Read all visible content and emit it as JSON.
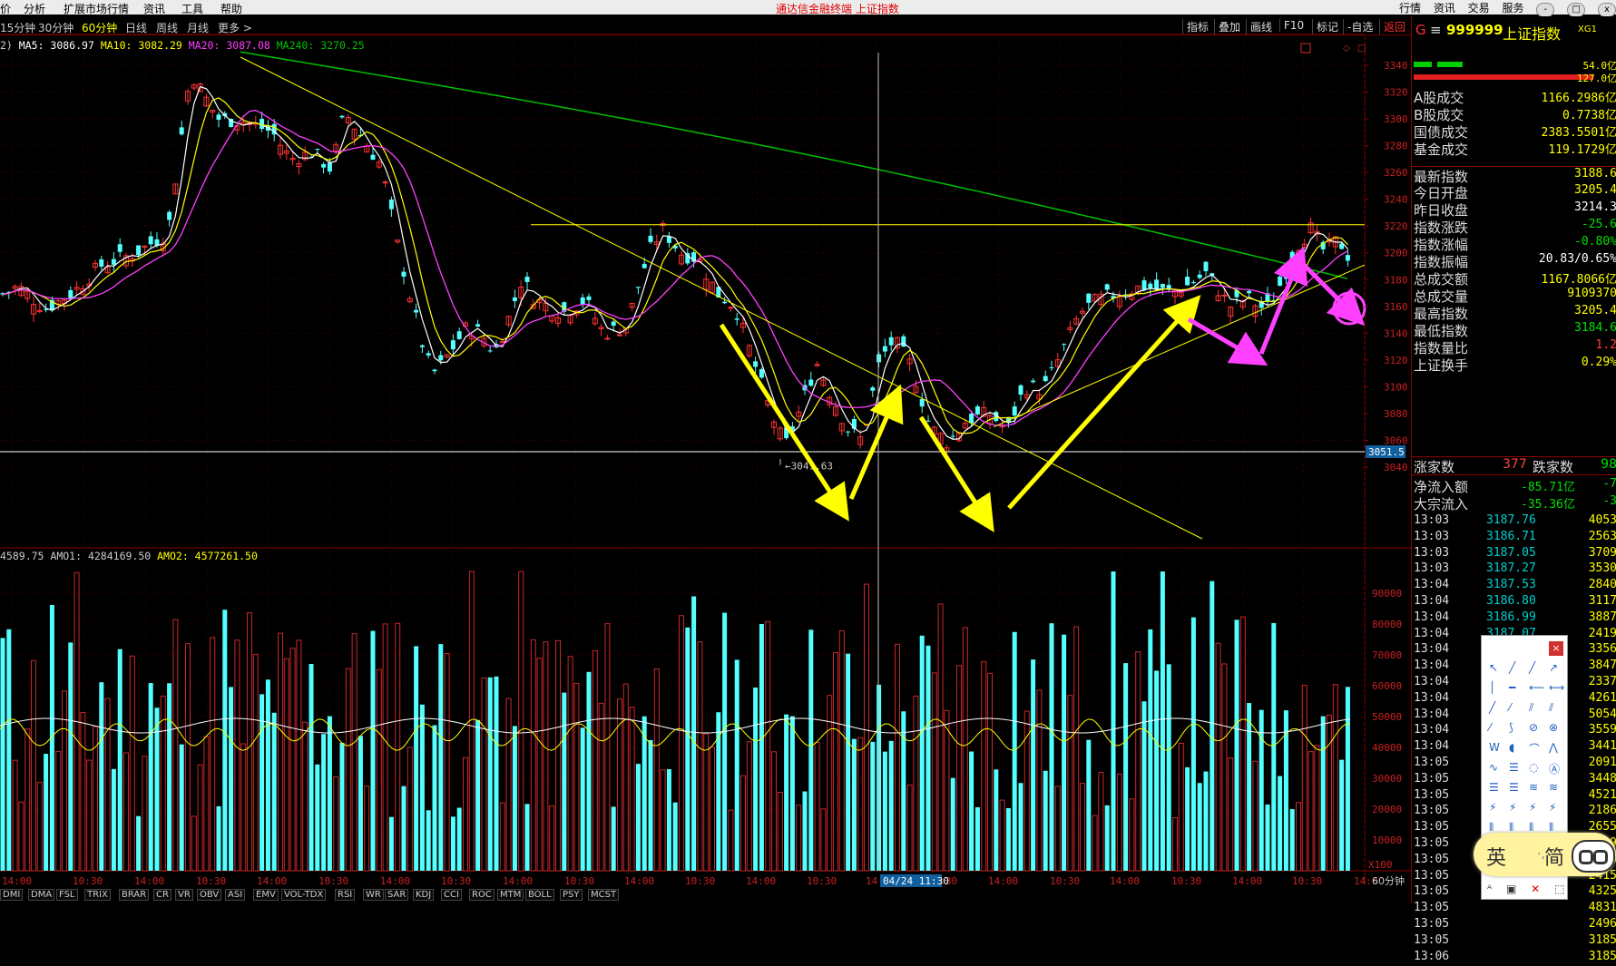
{
  "menubar": {
    "items": [
      "价",
      "分析",
      "扩展市场行情",
      "资讯",
      "工具",
      "帮助"
    ],
    "title": "通达信金融终端    上证指数",
    "right": [
      "行情",
      "资讯",
      "交易",
      "服务"
    ],
    "win_buttons": [
      "-",
      "□",
      "x"
    ]
  },
  "periods": [
    "15分钟",
    "30分钟",
    "60分钟",
    "日线",
    "周线",
    "月线",
    "更多 >"
  ],
  "active_period": "60分钟",
  "tools": [
    "指标",
    "叠加",
    "画线",
    "F10",
    "标记",
    "-自选",
    "返回"
  ],
  "ma_legend": {
    "prefix": "2)",
    "ma5": "MA5: 3086.97",
    "ma10": "MA10: 3082.29",
    "ma20": "MA20: 3087.08",
    "ma240": "MA240: 3270.25",
    "colors": {
      "ma5": "#ffffff",
      "ma10": "#ffff00",
      "ma20": "#ff40ff",
      "ma240": "#00c000"
    }
  },
  "vol_legend": {
    "vol": "4589.75",
    "amo1": "AMO1: 4284169.50",
    "amo2": "AMO2: 4577261.50"
  },
  "price_axis": [
    "3340",
    "3320",
    "3300",
    "3280",
    "3260",
    "3240",
    "3220",
    "3200",
    "3180",
    "3160",
    "3140",
    "3120",
    "3100",
    "3080",
    "3060",
    "3040"
  ],
  "price_marker": "3051.5",
  "low_label": "3041.63",
  "vol_axis": [
    "90000",
    "80000",
    "70000",
    "60000",
    "50000",
    "40000",
    "30000",
    "20000",
    "10000"
  ],
  "vol_unit": "X100",
  "x_axis": [
    "14:00",
    "10:30",
    "14:00",
    "10:30",
    "14:00",
    "10:30",
    "14:00",
    "10:30",
    "14:00",
    "10:30",
    "14:00",
    "10:30",
    "14:00",
    "10:30",
    "14:00",
    "10:30",
    "14:00",
    "10:30",
    "14:00",
    "10:30",
    "14:00",
    "10:30",
    "14:0"
  ],
  "cursor_label": "04/24 11:30",
  "x_unit": "60分钟",
  "bottom_tabs": [
    "DMI",
    "DMA",
    "FSL",
    "TRIX",
    "BRAR",
    "CR",
    "VR",
    "OBV",
    "ASI",
    "EMV",
    "VOL-TDX",
    "RSI",
    "WR",
    "SAR",
    "KDJ",
    "CCI",
    "ROC",
    "MTM",
    "BOLL",
    "PSY",
    "MCST"
  ],
  "right_panel": {
    "header_g": "G",
    "header_code": "999999",
    "header_name": "上证指数",
    "header_tag": "XG1",
    "bar_vals": [
      "54.0亿",
      "127.0亿"
    ],
    "turnover": [
      {
        "label": "A股成交",
        "value": "1166.2986亿"
      },
      {
        "label": "B股成交",
        "value": "0.7738亿"
      },
      {
        "label": "国债成交",
        "value": "2383.5501亿"
      },
      {
        "label": "基金成交",
        "value": "119.1729亿"
      }
    ],
    "stats": [
      {
        "label": "最新指数",
        "value": "3188.6",
        "color": "#ffff00"
      },
      {
        "label": "今日开盘",
        "value": "3205.4",
        "color": "#ffff00"
      },
      {
        "label": "昨日收盘",
        "value": "3214.3",
        "color": "#ffffff"
      },
      {
        "label": "指数涨跌",
        "value": "-25.6",
        "color": "#00e000"
      },
      {
        "label": "指数涨幅",
        "value": "-0.80%",
        "color": "#00e000"
      },
      {
        "label": "指数振幅",
        "value": "20.83/0.65%",
        "color": "#ffffff"
      },
      {
        "label": "总成交额",
        "value": "1167.8066亿",
        "color": "#ffff00"
      },
      {
        "label": "总成交量",
        "value": "9109370",
        "color": "#ffff00"
      },
      {
        "label": "最高指数",
        "value": "3205.4",
        "color": "#ffff00"
      },
      {
        "label": "最低指数",
        "value": "3184.6",
        "color": "#00e000"
      },
      {
        "label": "指数量比",
        "value": "1.2",
        "color": "#ff4040"
      },
      {
        "label": "上证换手",
        "value": "0.29%",
        "color": "#ffff00"
      }
    ],
    "updown": {
      "up_label": "涨家数",
      "up": "377",
      "down_label": "跌家数",
      "down": "98"
    },
    "flows": [
      {
        "label": "净流入额",
        "value": "-85.71亿",
        "extra": "-7"
      },
      {
        "label": "大宗流入",
        "value": "-35.36亿",
        "extra": "-3"
      }
    ],
    "ticks": [
      {
        "t": "13:03",
        "p": "3187.76",
        "v": "4053"
      },
      {
        "t": "13:03",
        "p": "3186.71",
        "v": "2563"
      },
      {
        "t": "13:03",
        "p": "3187.05",
        "v": "3709"
      },
      {
        "t": "13:03",
        "p": "3187.27",
        "v": "3530"
      },
      {
        "t": "13:04",
        "p": "3187.53",
        "v": "2840"
      },
      {
        "t": "13:04",
        "p": "3186.80",
        "v": "3117"
      },
      {
        "t": "13:04",
        "p": "3186.99",
        "v": "3887"
      },
      {
        "t": "13:04",
        "p": "3187.07",
        "v": "2419"
      },
      {
        "t": "13:04",
        "p": "3187.04",
        "v": "3356"
      },
      {
        "t": "13:04",
        "p": "3187.26",
        "v": "3847"
      },
      {
        "t": "13:04",
        "p": "3186.81",
        "v": "2337"
      },
      {
        "t": "13:04",
        "p": "3187.06",
        "v": "4261"
      },
      {
        "t": "13:04",
        "p": "3186.98",
        "v": "5054"
      },
      {
        "t": "13:04",
        "p": "",
        "v": "3559"
      },
      {
        "t": "13:04",
        "p": "",
        "v": "3441"
      },
      {
        "t": "13:05",
        "p": "",
        "v": "2091"
      },
      {
        "t": "13:05",
        "p": "",
        "v": "3448"
      },
      {
        "t": "13:05",
        "p": "",
        "v": "4521"
      },
      {
        "t": "13:05",
        "p": "",
        "v": "2186"
      },
      {
        "t": "13:05",
        "p": "",
        "v": "2655"
      },
      {
        "t": "13:05",
        "p": "",
        "v": "3789"
      },
      {
        "t": "13:05",
        "p": "",
        "v": "3606"
      },
      {
        "t": "13:05",
        "p": "",
        "v": "2415"
      },
      {
        "t": "13:05",
        "p": "",
        "v": "4325"
      },
      {
        "t": "13:05",
        "p": "",
        "v": "4831"
      },
      {
        "t": "13:05",
        "p": "",
        "v": "2496"
      },
      {
        "t": "13:05",
        "p": "",
        "v": "3185"
      },
      {
        "t": "13:06",
        "p": "",
        "v": "3185"
      }
    ]
  },
  "ime": {
    "lang": "英",
    "mode": "简"
  },
  "chart_data": {
    "type": "candlestick",
    "ylim": [
      3030,
      3350
    ],
    "hlines": [
      3221,
      3051.5
    ],
    "low_annotation": 3041.63
  }
}
